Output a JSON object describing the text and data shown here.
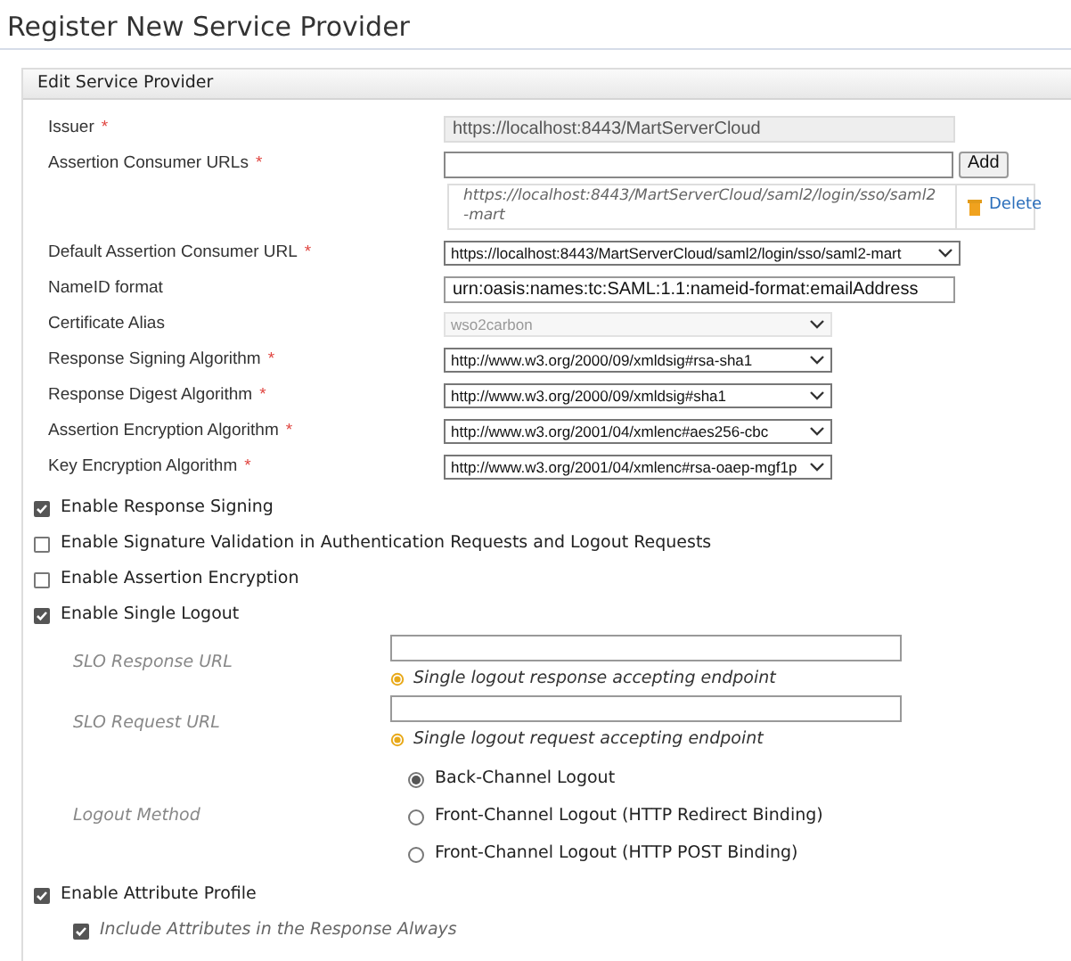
{
  "title": "Register New Service Provider",
  "panel": {
    "header": "Edit Service Provider",
    "fields": [
      {
        "kind": "text",
        "label": "Issuer",
        "marker": "*",
        "value": "https://localhost:8443/MartServerCloud",
        "disabled": true
      },
      {
        "kind": "url_list",
        "label": "Assertion Consumer URLs",
        "marker": "*",
        "button": "Add",
        "urls": [
          {
            "url": "https://localhost:8443/MartServerCloud/saml2/login/sso/saml2-mart",
            "action": "Delete"
          }
        ]
      },
      {
        "kind": "select",
        "label": "Default Assertion Consumer URL",
        "marker": "*",
        "value": "https://localhost:8443/MartServerCloud/saml2/login/sso/saml2-mart",
        "disabled": false,
        "wide": true
      },
      {
        "kind": "text",
        "label": "NameID format",
        "value": "urn:oasis:names:tc:SAML:1.1:nameid-format:emailAddress",
        "disabled": false
      },
      {
        "kind": "select",
        "label": "Certificate Alias",
        "value": "wso2carbon",
        "disabled": true,
        "wide": false
      },
      {
        "kind": "select",
        "label": "Response Signing Algorithm",
        "marker": "*",
        "value": "http://www.w3.org/2000/09/xmldsig#rsa-sha1",
        "disabled": false,
        "wide": false
      },
      {
        "kind": "select",
        "label": "Response Digest Algorithm",
        "marker": "*",
        "value": "http://www.w3.org/2000/09/xmldsig#sha1",
        "disabled": false,
        "wide": false
      },
      {
        "kind": "select",
        "label": "Assertion Encryption Algorithm",
        "marker": "*",
        "value": "http://www.w3.org/2001/04/xmlenc#aes256-cbc",
        "disabled": false,
        "wide": false
      },
      {
        "kind": "select",
        "label": "Key Encryption Algorithm",
        "marker": "*",
        "value": "http://www.w3.org/2001/04/xmlenc#rsa-oaep-mgf1p",
        "disabled": false,
        "wide": false
      }
    ],
    "settings": [
      {
        "kind": "checkbox",
        "label": "Enable Response Signing",
        "checked": true
      },
      {
        "kind": "checkbox",
        "label": "Enable Signature Validation in Authentication Requests and Logout Requests",
        "checked": false
      },
      {
        "kind": "checkbox",
        "label": "Enable Assertion Encryption",
        "checked": false
      },
      {
        "kind": "checkbox",
        "label": "Enable Single Logout",
        "checked": true,
        "children": [
          {
            "kind": "url_field",
            "label": "SLO Response URL",
            "hint": "Single logout response accepting endpoint"
          },
          {
            "kind": "url_field",
            "label": "SLO Request URL",
            "hint": "Single logout request accepting endpoint"
          },
          {
            "kind": "radio_group",
            "label": "Logout Method",
            "options": [
              {
                "label": "Back-Channel Logout",
                "selected": true
              },
              {
                "label": "Front-Channel Logout (HTTP Redirect Binding)",
                "selected": false
              },
              {
                "label": "Front-Channel Logout (HTTP POST Binding)",
                "selected": false
              }
            ]
          }
        ]
      },
      {
        "kind": "checkbox",
        "label": "Enable Attribute Profile",
        "checked": true,
        "children": [
          {
            "kind": "checkbox",
            "label": "Include Attributes in the Response Always",
            "checked": true
          }
        ]
      }
    ]
  }
}
